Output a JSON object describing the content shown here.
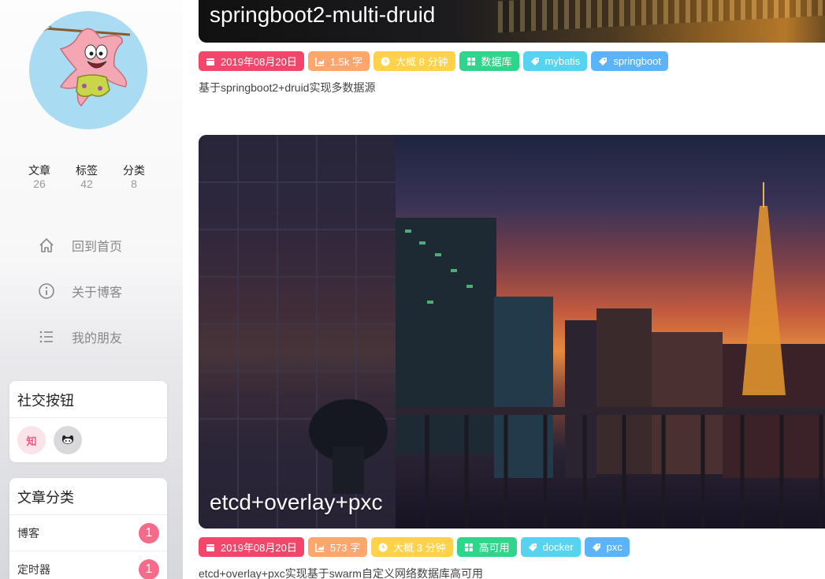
{
  "profile": {
    "stats": [
      {
        "label": "文章",
        "value": "26"
      },
      {
        "label": "标签",
        "value": "42"
      },
      {
        "label": "分类",
        "value": "8"
      }
    ]
  },
  "nav": [
    {
      "label": "回到首页",
      "icon": "home-icon"
    },
    {
      "label": "关于博客",
      "icon": "info-icon"
    },
    {
      "label": "我的朋友",
      "icon": "list-icon"
    }
  ],
  "social": {
    "title": "社交按钮",
    "zhihu_label": "知"
  },
  "categories": {
    "title": "文章分类",
    "items": [
      {
        "name": "博客",
        "count": "1"
      },
      {
        "name": "定时器",
        "count": "1"
      }
    ]
  },
  "posts": [
    {
      "title": "springboot2-multi-druid",
      "date": "2019年08月20日",
      "words": "1.5k 字",
      "read_time": "大概 8 分钟",
      "category": "数据库",
      "tags": [
        "mybatis",
        "springboot"
      ],
      "description": "基于springboot2+druid实现多数据源"
    },
    {
      "title": "etcd+overlay+pxc",
      "date": "2019年08月20日",
      "words": "573 字",
      "read_time": "大概 3 分钟",
      "category": "高可用",
      "tags": [
        "docker",
        "pxc"
      ],
      "description": "etcd+overlay+pxc实现基于swarm自定义网络数据库高可用"
    }
  ],
  "colors": {
    "date_tag": "#f4456b",
    "words_tag": "#ffa56e",
    "time_tag": "#ffd24a",
    "category_tag": "#2fd58a",
    "label_tag": "#56d3ee",
    "label_tag_2": "#5cb3f7",
    "count_badge": "#f56b8a"
  }
}
